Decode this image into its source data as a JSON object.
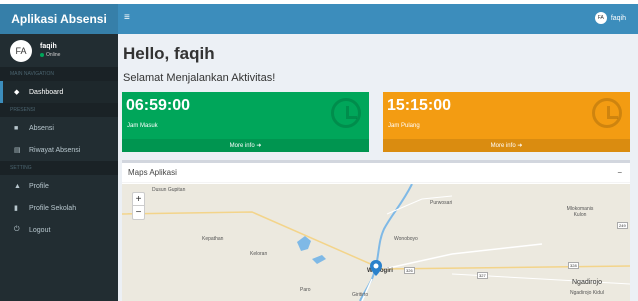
{
  "app": {
    "title": "Aplikasi Absensi"
  },
  "user": {
    "initials": "FA",
    "name": "faqih",
    "status": "Online"
  },
  "sidebar": {
    "headers": [
      "MAIN NAVIGATION",
      "PRESENSI",
      "SETTING"
    ],
    "items": [
      {
        "label": "Dashboard",
        "icon": "dashboard-icon"
      },
      {
        "label": "Absensi",
        "icon": "camera-icon"
      },
      {
        "label": "Riwayat Absensi",
        "icon": "book-icon"
      },
      {
        "label": "Profile",
        "icon": "user-icon"
      },
      {
        "label": "Profile Sekolah",
        "icon": "bookmark-icon"
      },
      {
        "label": "Logout",
        "icon": "power-icon"
      }
    ]
  },
  "navbar": {
    "menu_icon": "≡",
    "user_initials": "FA",
    "user_name": "faqih"
  },
  "main": {
    "greeting": "Hello, faqih",
    "subtitle": "Selamat Menjalankan Aktivitas!",
    "boxes": [
      {
        "value": "06:59:00",
        "label": "Jam Masuk",
        "footer": "More info",
        "color": "#00a65a"
      },
      {
        "value": "15:15:00",
        "label": "Jam Pulang",
        "footer": "More info",
        "color": "#f39c12"
      }
    ],
    "map": {
      "title": "Maps Aplikasi",
      "collapse": "−",
      "zoom_in": "+",
      "zoom_out": "−",
      "places": [
        "Dusun Gupitan",
        "Purwosari",
        "Mlokomanis Kulon",
        "Kepathan",
        "Wonoboyo",
        "Keloran",
        "Wonogiri",
        "Ngadirojo",
        "Ngadirojo Kidul",
        "Paro",
        "Giritirto"
      ],
      "roads": [
        "249",
        "326",
        "327",
        "328"
      ]
    }
  }
}
